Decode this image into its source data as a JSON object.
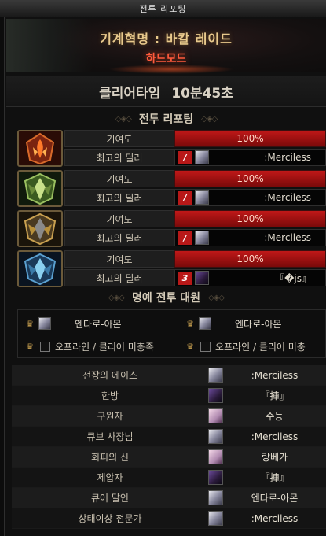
{
  "window": {
    "title": "전투 리포팅"
  },
  "raid": {
    "name": "기계혁명 : 바칼 레이드",
    "mode": "하드모드"
  },
  "clear": {
    "label": "클리어타임",
    "time": "10분45초"
  },
  "report_section": {
    "title": "전투 리포팅"
  },
  "reports": [
    {
      "icon": "red-fire-crest-icon",
      "contrib_label": "기여도",
      "contrib": "100%",
      "contrib_fraction": 1.0,
      "dealer_label": "최고의 딜러",
      "class_badge": "/",
      "avatar": "light",
      "dealer": ":Merciless"
    },
    {
      "icon": "green-crest-icon",
      "contrib_label": "기여도",
      "contrib": "100%",
      "contrib_fraction": 1.0,
      "dealer_label": "최고의 딜러",
      "class_badge": "/",
      "avatar": "light",
      "dealer": ":Merciless"
    },
    {
      "icon": "gold-crest-icon",
      "contrib_label": "기여도",
      "contrib": "100%",
      "contrib_fraction": 1.0,
      "dealer_label": "최고의 딜러",
      "class_badge": "/",
      "avatar": "light",
      "dealer": ":Merciless"
    },
    {
      "icon": "blue-crest-icon",
      "contrib_label": "기여도",
      "contrib": "100%",
      "contrib_fraction": 1.0,
      "dealer_label": "최고의 딜러",
      "class_badge": "3",
      "avatar": "dark",
      "dealer": "『�js』"
    }
  ],
  "honor_section": {
    "title": "명예 전투 대원"
  },
  "honor": {
    "row1": [
      {
        "name": "엔타로-아몬"
      },
      {
        "name": "엔타로-아몬"
      }
    ],
    "row2": [
      {
        "status": "오프라인 / 클리어 미충족"
      },
      {
        "status": "오프라인 / 클리어 미충"
      }
    ]
  },
  "awards": [
    {
      "title": "전장의 에이스",
      "avatar": "light",
      "name": ":Merciless"
    },
    {
      "title": "한방",
      "avatar": "dark",
      "name": "『捙』"
    },
    {
      "title": "구원자",
      "avatar": "pink",
      "name": "수능"
    },
    {
      "title": "큐브 사장님",
      "avatar": "light",
      "name": ":Merciless"
    },
    {
      "title": "회피의 신",
      "avatar": "pink",
      "name": "랑베가"
    },
    {
      "title": "제압자",
      "avatar": "dark",
      "name": "『捙』"
    },
    {
      "title": "큐어 달인",
      "avatar": "light",
      "name": "엔타로-아몬"
    },
    {
      "title": "상태이상 전문가",
      "avatar": "light",
      "name": ":Merciless"
    }
  ],
  "colors": {
    "accent": "#e8c98c",
    "mode": "#ff5a3c",
    "bar": "#c01818"
  }
}
